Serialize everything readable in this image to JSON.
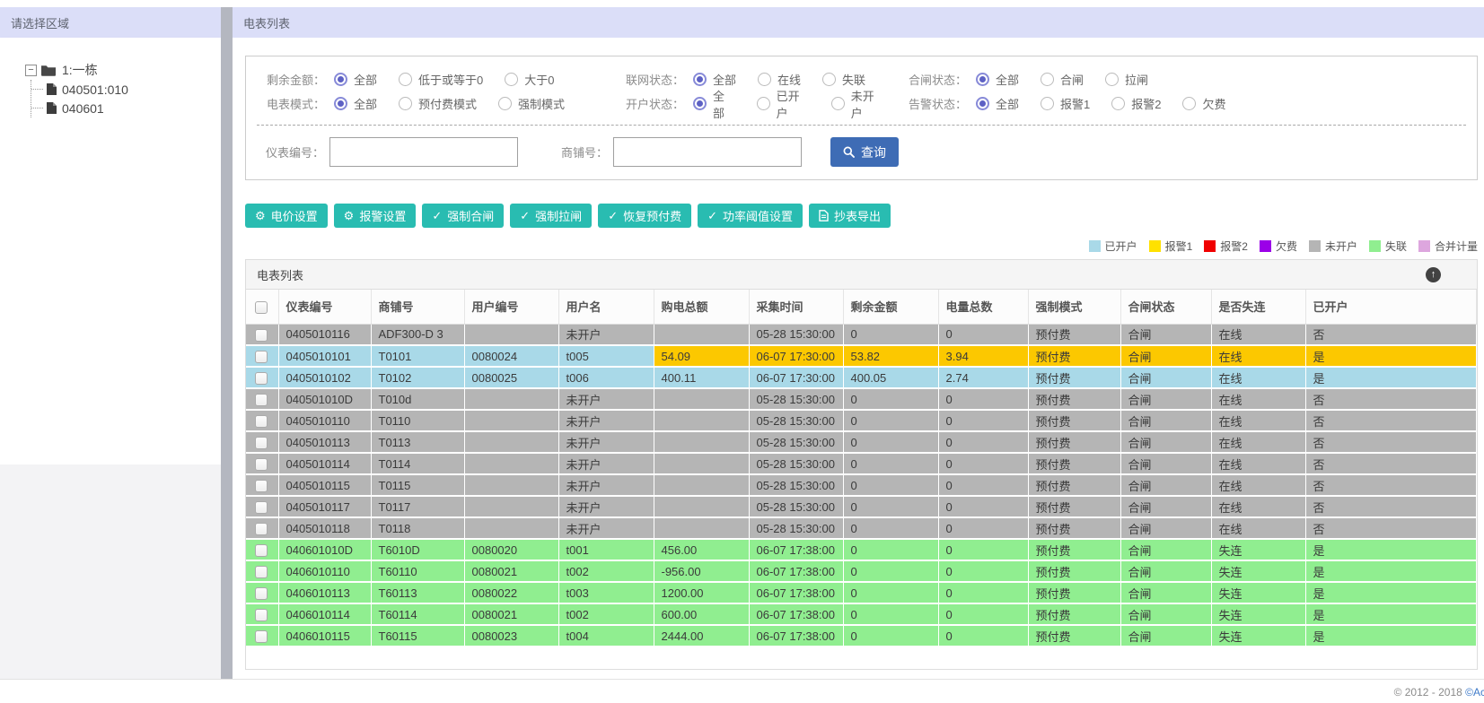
{
  "sidebar": {
    "title": "请选择区域",
    "tree": {
      "expander": "−",
      "root_label": "1:一栋",
      "children": [
        "040501:010",
        "040601"
      ]
    }
  },
  "header": {
    "title": "电表列表"
  },
  "filters": {
    "rows": [
      [
        {
          "label": "剩余金额：",
          "options": [
            "全部",
            "低于或等于0",
            "大于0"
          ],
          "selected": 0
        },
        {
          "label": "联网状态：",
          "options": [
            "全部",
            "在线",
            "失联"
          ],
          "selected": 0
        },
        {
          "label": "合闸状态：",
          "options": [
            "全部",
            "合闸",
            "拉闸"
          ],
          "selected": 0
        }
      ],
      [
        {
          "label": "电表模式：",
          "options": [
            "全部",
            "预付费模式",
            "强制模式"
          ],
          "selected": 0
        },
        {
          "label": "开户状态：",
          "options": [
            "全部",
            "已开户",
            "未开户"
          ],
          "selected": 0
        },
        {
          "label": "告警状态：",
          "options": [
            "全部",
            "报警1",
            "报警2",
            "欠费"
          ],
          "selected": 0
        }
      ]
    ],
    "inputs": [
      {
        "label": "仪表编号：",
        "value": ""
      },
      {
        "label": "商铺号：",
        "value": ""
      }
    ],
    "search": {
      "label": "查询",
      "icon": "magnifier-icon",
      "color": "#3e6cb5"
    }
  },
  "toolbar": {
    "color": "#29bcb1",
    "buttons": [
      {
        "icon": "gear-icon",
        "label": "电价设置"
      },
      {
        "icon": "gear-icon",
        "label": "报警设置"
      },
      {
        "icon": "check-icon",
        "label": "强制合闸"
      },
      {
        "icon": "check-icon",
        "label": "强制拉闸"
      },
      {
        "icon": "check-icon",
        "label": "恢复预付费"
      },
      {
        "icon": "check-icon",
        "label": "功率阈值设置"
      },
      {
        "icon": "doc-icon",
        "label": "抄表导出"
      }
    ]
  },
  "legend": {
    "items": [
      {
        "label": "已开户",
        "color": "#a9d9e8"
      },
      {
        "label": "报警1",
        "color": "#ffe100"
      },
      {
        "label": "报警2",
        "color": "#f00000"
      },
      {
        "label": "欠费",
        "color": "#9b00e8"
      },
      {
        "label": "未开户",
        "color": "#b5b5b5"
      },
      {
        "label": "失联",
        "color": "#90ee90"
      },
      {
        "label": "合并计量",
        "color": "#dda6de"
      }
    ]
  },
  "table": {
    "panel_title": "电表列表",
    "collapse_icon": "↑",
    "columns": [
      "仪表编号",
      "商铺号",
      "用户编号",
      "用户名",
      "购电总额",
      "采集时间",
      "剩余金额",
      "电量总数",
      "强制模式",
      "合闸状态",
      "是否失连",
      "已开户"
    ],
    "rows": [
      {
        "status": "gray",
        "cells": [
          "0405010116",
          "ADF300-D 3",
          "",
          "未开户",
          "",
          "05-28 15:30:00",
          "0",
          "0",
          "预付费",
          "合闸",
          "在线",
          "否"
        ]
      },
      {
        "status": "mixed",
        "cells": [
          "0405010101",
          "T0101",
          "0080024",
          "t005",
          "54.09",
          "06-07 17:30:00",
          "53.82",
          "3.94",
          "预付费",
          "合闸",
          "在线",
          "是"
        ]
      },
      {
        "status": "blue",
        "cells": [
          "0405010102",
          "T0102",
          "0080025",
          "t006",
          "400.11",
          "06-07 17:30:00",
          "400.05",
          "2.74",
          "预付费",
          "合闸",
          "在线",
          "是"
        ]
      },
      {
        "status": "gray",
        "cells": [
          "040501010D",
          "T010d",
          "",
          "未开户",
          "",
          "05-28 15:30:00",
          "0",
          "0",
          "预付费",
          "合闸",
          "在线",
          "否"
        ]
      },
      {
        "status": "gray",
        "cells": [
          "0405010110",
          "T0110",
          "",
          "未开户",
          "",
          "05-28 15:30:00",
          "0",
          "0",
          "预付费",
          "合闸",
          "在线",
          "否"
        ]
      },
      {
        "status": "gray",
        "cells": [
          "0405010113",
          "T0113",
          "",
          "未开户",
          "",
          "05-28 15:30:00",
          "0",
          "0",
          "预付费",
          "合闸",
          "在线",
          "否"
        ]
      },
      {
        "status": "gray",
        "cells": [
          "0405010114",
          "T0114",
          "",
          "未开户",
          "",
          "05-28 15:30:00",
          "0",
          "0",
          "预付费",
          "合闸",
          "在线",
          "否"
        ]
      },
      {
        "status": "gray",
        "cells": [
          "0405010115",
          "T0115",
          "",
          "未开户",
          "",
          "05-28 15:30:00",
          "0",
          "0",
          "预付费",
          "合闸",
          "在线",
          "否"
        ]
      },
      {
        "status": "gray",
        "cells": [
          "0405010117",
          "T0117",
          "",
          "未开户",
          "",
          "05-28 15:30:00",
          "0",
          "0",
          "预付费",
          "合闸",
          "在线",
          "否"
        ]
      },
      {
        "status": "gray",
        "cells": [
          "0405010118",
          "T0118",
          "",
          "未开户",
          "",
          "05-28 15:30:00",
          "0",
          "0",
          "预付费",
          "合闸",
          "在线",
          "否"
        ]
      },
      {
        "status": "green",
        "cells": [
          "040601010D",
          "T6010D",
          "0080020",
          "t001",
          "456.00",
          "06-07 17:38:00",
          "0",
          "0",
          "预付费",
          "合闸",
          "失连",
          "是"
        ]
      },
      {
        "status": "green",
        "cells": [
          "0406010110",
          "T60110",
          "0080021",
          "t002",
          "-956.00",
          "06-07 17:38:00",
          "0",
          "0",
          "预付费",
          "合闸",
          "失连",
          "是"
        ]
      },
      {
        "status": "green",
        "cells": [
          "0406010113",
          "T60113",
          "0080022",
          "t003",
          "1200.00",
          "06-07 17:38:00",
          "0",
          "0",
          "预付费",
          "合闸",
          "失连",
          "是"
        ]
      },
      {
        "status": "green",
        "cells": [
          "0406010114",
          "T60114",
          "0080021",
          "t002",
          "600.00",
          "06-07 17:38:00",
          "0",
          "0",
          "预付费",
          "合闸",
          "失连",
          "是"
        ]
      },
      {
        "status": "green",
        "cells": [
          "0406010115",
          "T60115",
          "0080023",
          "t004",
          "2444.00",
          "06-07 17:38:00",
          "0",
          "0",
          "预付费",
          "合闸",
          "失连",
          "是"
        ]
      }
    ]
  },
  "footer": {
    "copyright": "© 2012 - 2018",
    "brand": "©Acr"
  }
}
